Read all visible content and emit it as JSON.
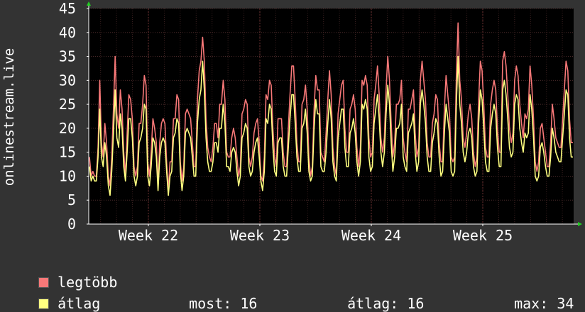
{
  "chart_data": {
    "type": "line",
    "ylabel": "onlinestream.live",
    "ylim": [
      0,
      45
    ],
    "yticks": [
      0,
      5,
      10,
      15,
      20,
      25,
      30,
      35,
      40,
      45
    ],
    "xticks": [
      "Week 22",
      "Week 23",
      "Week 24",
      "Week 25"
    ],
    "grid": true,
    "colors": {
      "background": "#000000",
      "page": "#333333",
      "grid": "#4a2a2a",
      "axis": "#ffffff"
    },
    "series": [
      {
        "name": "legtöbb",
        "color": "#f87878",
        "values": [
          14,
          10,
          11,
          10,
          10,
          16,
          30,
          17,
          14,
          21,
          17,
          10,
          8,
          14,
          24,
          35,
          23,
          20,
          28,
          24,
          15,
          10,
          19,
          27,
          26,
          22,
          12,
          10,
          12,
          21,
          21,
          25,
          31,
          29,
          13,
          10,
          15,
          22,
          20,
          17,
          8,
          17,
          21,
          22,
          21,
          13,
          7,
          13,
          13,
          22,
          22,
          27,
          26,
          13,
          9,
          12,
          23,
          24,
          23,
          22,
          17,
          12,
          12,
          26,
          32,
          34,
          39,
          34,
          22,
          16,
          14,
          13,
          16,
          21,
          21,
          18,
          25,
          25,
          30,
          26,
          15,
          14,
          14,
          18,
          20,
          18,
          14,
          10,
          12,
          23,
          24,
          26,
          25,
          14,
          12,
          14,
          19,
          21,
          22,
          17,
          10,
          9,
          14,
          27,
          26,
          30,
          29,
          20,
          14,
          12,
          22,
          22,
          22,
          15,
          12,
          12,
          20,
          27,
          33,
          33,
          26,
          17,
          13,
          13,
          25,
          26,
          29,
          24,
          14,
          10,
          12,
          24,
          31,
          28,
          28,
          15,
          14,
          13,
          19,
          26,
          32,
          27,
          16,
          12,
          10,
          23,
          26,
          29,
          30,
          20,
          15,
          15,
          24,
          25,
          27,
          24,
          16,
          12,
          16,
          30,
          29,
          31,
          29,
          18,
          14,
          15,
          26,
          29,
          33,
          27,
          18,
          15,
          18,
          28,
          35,
          30,
          21,
          14,
          17,
          25,
          25,
          26,
          30,
          18,
          15,
          13,
          24,
          24,
          26,
          28,
          19,
          14,
          16,
          30,
          34,
          30,
          26,
          17,
          14,
          14,
          21,
          23,
          27,
          26,
          17,
          13,
          13,
          24,
          31,
          27,
          23,
          14,
          13,
          14,
          31,
          42,
          30,
          26,
          18,
          16,
          19,
          23,
          25,
          22,
          15,
          12,
          14,
          26,
          34,
          32,
          25,
          16,
          14,
          14,
          25,
          28,
          30,
          28,
          20,
          15,
          15,
          34,
          36,
          33,
          27,
          20,
          17,
          19,
          30,
          33,
          31,
          25,
          21,
          18,
          23,
          22,
          24,
          33,
          29,
          22,
          13,
          11,
          13,
          20,
          21,
          18,
          15,
          12,
          12,
          17,
          25,
          22,
          18,
          17,
          16,
          16,
          22,
          28,
          34,
          32,
          22,
          17,
          17
        ]
      },
      {
        "name": "átlag",
        "color": "#ffff80",
        "values": [
          12,
          9,
          10,
          9,
          9,
          14,
          24,
          14,
          12,
          17,
          14,
          8,
          6,
          11,
          19,
          28,
          18,
          16,
          23,
          20,
          12,
          9,
          15,
          22,
          22,
          18,
          10,
          8,
          10,
          17,
          18,
          20,
          25,
          24,
          10,
          8,
          12,
          18,
          17,
          14,
          7,
          14,
          17,
          18,
          17,
          11,
          6,
          10,
          11,
          18,
          19,
          22,
          21,
          11,
          7,
          10,
          19,
          20,
          19,
          18,
          14,
          10,
          10,
          21,
          26,
          28,
          34,
          28,
          18,
          13,
          11,
          11,
          13,
          17,
          17,
          15,
          20,
          20,
          25,
          21,
          12,
          12,
          11,
          15,
          16,
          15,
          11,
          8,
          10,
          18,
          19,
          21,
          20,
          12,
          10,
          11,
          15,
          17,
          18,
          14,
          9,
          7,
          11,
          22,
          21,
          25,
          24,
          16,
          11,
          10,
          17,
          18,
          18,
          12,
          10,
          10,
          16,
          22,
          27,
          27,
          21,
          14,
          11,
          11,
          20,
          21,
          24,
          19,
          11,
          9,
          10,
          20,
          26,
          23,
          23,
          12,
          11,
          11,
          15,
          21,
          26,
          22,
          13,
          10,
          9,
          18,
          21,
          24,
          24,
          16,
          12,
          12,
          19,
          20,
          22,
          19,
          13,
          10,
          13,
          25,
          24,
          26,
          24,
          14,
          11,
          12,
          21,
          24,
          27,
          22,
          15,
          12,
          15,
          23,
          29,
          25,
          17,
          11,
          14,
          20,
          20,
          21,
          25,
          14,
          12,
          11,
          19,
          20,
          21,
          23,
          15,
          11,
          13,
          25,
          28,
          25,
          21,
          14,
          11,
          11,
          17,
          19,
          22,
          21,
          14,
          10,
          11,
          19,
          25,
          22,
          19,
          11,
          10,
          11,
          25,
          35,
          25,
          21,
          15,
          13,
          15,
          19,
          20,
          18,
          12,
          10,
          11,
          21,
          28,
          26,
          20,
          13,
          11,
          11,
          20,
          23,
          25,
          23,
          16,
          12,
          12,
          28,
          30,
          27,
          22,
          16,
          14,
          15,
          25,
          27,
          26,
          20,
          17,
          15,
          19,
          18,
          19,
          27,
          24,
          18,
          10,
          9,
          10,
          16,
          17,
          15,
          12,
          10,
          10,
          14,
          20,
          18,
          15,
          14,
          13,
          13,
          18,
          23,
          28,
          27,
          18,
          14,
          14
        ]
      }
    ]
  },
  "legend": {
    "max_label": "legtöbb",
    "avg_label": "átlag",
    "stats": [
      {
        "label": "most:",
        "value": "16"
      },
      {
        "label": "átlag:",
        "value": "16"
      },
      {
        "label": "max:",
        "value": "34"
      }
    ]
  }
}
